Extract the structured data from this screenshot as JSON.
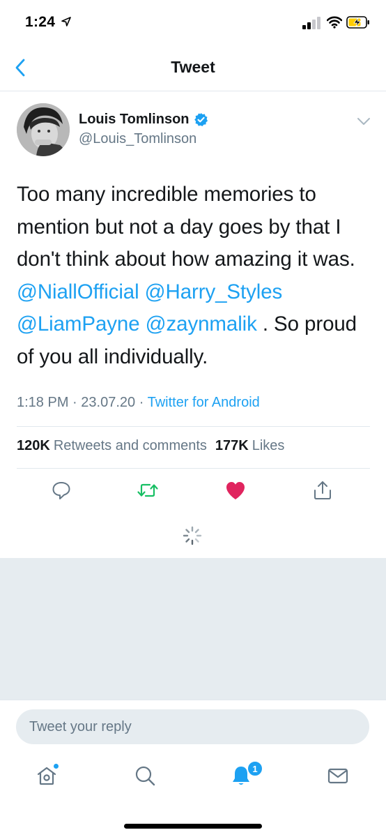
{
  "status_bar": {
    "time": "1:24",
    "icons": [
      "location-arrow-icon",
      "signal-icon",
      "wifi-icon",
      "battery-charging-icon"
    ]
  },
  "header": {
    "title": "Tweet",
    "back_icon": "chevron-left-icon"
  },
  "tweet": {
    "author_name": "Louis Tomlinson",
    "verified": true,
    "handle": "@Louis_Tomlinson",
    "text_part1": "Too many incredible memories to mention but not a day goes by that I don't think about how amazing it was. ",
    "mentions": [
      "@NiallOfficial",
      "@Harry_Styles",
      "@LiamPayne",
      "@zaynmalik"
    ],
    "text_part2": " . So proud of you all individually.",
    "time": "1:18 PM",
    "date": "23.07.20",
    "separator": "·",
    "source": "Twitter for Android",
    "retweets_count": "120K",
    "retweets_label": "Retweets and comments",
    "likes_count": "177K",
    "likes_label": "Likes",
    "liked": true
  },
  "colors": {
    "accent": "#1da1f2",
    "retweet_green": "#17bf63",
    "like_red": "#e0245e",
    "secondary_text": "#657786",
    "gray_background": "#e6ecf0"
  },
  "reply": {
    "placeholder": "Tweet your reply"
  },
  "tab_bar": {
    "tabs": [
      "home-icon",
      "search-icon",
      "notifications-icon",
      "messages-icon"
    ],
    "notifications_badge": "1"
  }
}
